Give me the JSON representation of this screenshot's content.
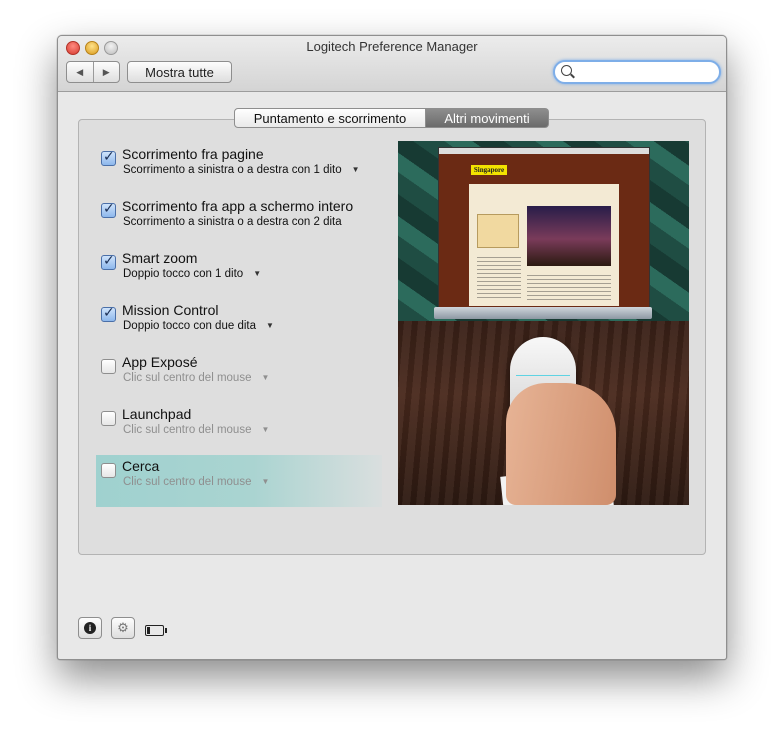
{
  "window": {
    "title": "Logitech Preference Manager"
  },
  "toolbar": {
    "back_icon": "◀",
    "forward_icon": "▶",
    "show_all_label": "Mostra tutte",
    "search_placeholder": ""
  },
  "tabs": [
    {
      "label": "Puntamento e scorrimento",
      "selected": false
    },
    {
      "label": "Altri movimenti",
      "selected": true
    }
  ],
  "options": [
    {
      "title": "Scorrimento fra pagine",
      "subtitle": "Scorrimento a sinistra o a destra con 1 dito",
      "checked": true,
      "has_menu": true,
      "enabled": true
    },
    {
      "title": "Scorrimento fra app a schermo intero",
      "subtitle": "Scorrimento a sinistra o a destra con 2 dita",
      "checked": true,
      "has_menu": false,
      "enabled": true
    },
    {
      "title": "Smart zoom",
      "subtitle": "Doppio tocco con 1 dito",
      "checked": true,
      "has_menu": true,
      "enabled": true
    },
    {
      "title": "Mission Control",
      "subtitle": "Doppio tocco con due dita",
      "checked": true,
      "has_menu": true,
      "enabled": true
    },
    {
      "title": "App Exposé",
      "subtitle": "Clic sul centro del mouse",
      "checked": false,
      "has_menu": true,
      "enabled": false
    },
    {
      "title": "Launchpad",
      "subtitle": "Clic sul centro del mouse",
      "checked": false,
      "has_menu": true,
      "enabled": false
    },
    {
      "title": "Cerca",
      "subtitle": "Clic sul centro del mouse",
      "checked": false,
      "has_menu": true,
      "enabled": false,
      "highlighted": true
    }
  ],
  "preview": {
    "site_logo": "Singapore"
  },
  "footer": {
    "info_icon": "i",
    "settings_icon": "⚙",
    "battery_icon": "battery-low-icon"
  },
  "colors": {
    "highlight": "#9fd1cf",
    "selected_tab": "#7b7b7b",
    "checkbox_checked": "#8db7ec",
    "search_focus": "#7eaee8"
  }
}
